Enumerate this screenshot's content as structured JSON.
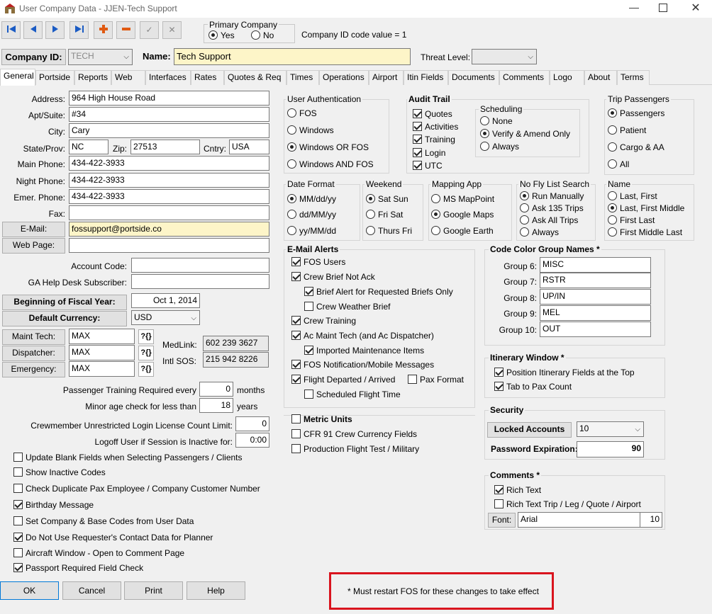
{
  "window": {
    "title": "User Company Data - JJEN-Tech Support"
  },
  "toolbar": {
    "primary_company_label": "Primary Company",
    "yes": "Yes",
    "no": "No",
    "company_id_code_text": "Company ID code value = 1"
  },
  "header": {
    "company_id_label": "Company ID:",
    "company_id_value": "TECH",
    "name_label": "Name:",
    "name_value": "Tech Support",
    "threat_level_label": "Threat Level:"
  },
  "tabs": [
    "General",
    "Portside",
    "Reports",
    "Web",
    "Interfaces",
    "Rates",
    "Quotes & Req",
    "Times",
    "Operations",
    "Airport",
    "Itin Fields",
    "Documents",
    "Comments",
    "Logo",
    "About",
    "Terms"
  ],
  "general": {
    "address_label": "Address:",
    "address": "964 High House Road",
    "apt_label": "Apt/Suite:",
    "apt": "#34",
    "city_label": "City:",
    "city": "Cary",
    "state_label": "State/Prov:",
    "state": "NC",
    "zip_label": "Zip:",
    "zip": "27513",
    "cntry_label": "Cntry:",
    "cntry": "USA",
    "main_phone_label": "Main Phone:",
    "main_phone": "434-422-3933",
    "night_phone_label": "Night Phone:",
    "night_phone": "434-422-3933",
    "emer_phone_label": "Emer. Phone:",
    "emer_phone": "434-422-3933",
    "fax_label": "Fax:",
    "email_button": "E-Mail:",
    "email": "fossupport@portside.co",
    "webpage_button": "Web Page:",
    "account_code_label": "Account Code:",
    "ga_help_label": "GA Help Desk Subscriber:",
    "fiscal_year_button": "Beginning of Fiscal Year:",
    "fiscal_year": "Oct 1, 2014",
    "currency_button": "Default Currency:",
    "currency": "USD",
    "maint_tech_button": "Maint Tech:",
    "maint_tech": "MAX",
    "dispatcher_button": "Dispatcher:",
    "dispatcher": "MAX",
    "emergency_button": "Emergency:",
    "emergency": "MAX",
    "pick_glyph": "?{}",
    "medlink_label": "MedLink:",
    "medlink": "602 239 3627",
    "intl_sos_label": "Intl SOS:",
    "intl_sos": "215 942 8226",
    "pax_training_label": "Passenger Training Required every",
    "pax_training_value": "0",
    "pax_training_unit": "months",
    "minor_age_label": "Minor age check for less than",
    "minor_age_value": "18",
    "minor_age_unit": "years",
    "crew_license_label": "Crewmember Unrestricted Login License Count Limit:",
    "crew_license_value": "0",
    "logoff_label": "Logoff User if Session is Inactive for:",
    "logoff_value": "0:00",
    "checks": [
      {
        "label": "Update Blank Fields when Selecting Passengers / Clients",
        "checked": false
      },
      {
        "label": "Show Inactive Codes",
        "checked": false
      },
      {
        "label": "Check Duplicate Pax Employee / Company Customer Number",
        "checked": false
      },
      {
        "label": "Birthday Message",
        "checked": true
      },
      {
        "label": "Set Company & Base Codes from User Data",
        "checked": false
      },
      {
        "label": "Do Not Use Requester's Contact Data for Planner",
        "checked": true
      },
      {
        "label": "Aircraft Window - Open to Comment Page",
        "checked": false
      },
      {
        "label": "Passport Required Field Check",
        "checked": true
      }
    ]
  },
  "user_auth": {
    "title": "User Authentication",
    "options": [
      "FOS",
      "Windows",
      "Windows OR FOS",
      "Windows AND FOS"
    ],
    "selected": 2
  },
  "audit_trail": {
    "title": "Audit Trail",
    "items": [
      {
        "label": "Quotes",
        "checked": true
      },
      {
        "label": "Activities",
        "checked": true
      },
      {
        "label": "Training",
        "checked": true
      },
      {
        "label": "Login",
        "checked": true
      },
      {
        "label": "UTC",
        "checked": true
      }
    ]
  },
  "scheduling": {
    "title": "Scheduling",
    "options": [
      "None",
      "Verify & Amend Only",
      "Always"
    ],
    "selected": 1
  },
  "trip_passengers": {
    "title": "Trip Passengers",
    "options": [
      "Passengers",
      "Patient",
      "Cargo & AA",
      "All"
    ],
    "selected": 0
  },
  "date_format": {
    "title": "Date Format",
    "options": [
      "MM/dd/yy",
      "dd/MM/yy",
      "yy/MM/dd"
    ],
    "selected": 0
  },
  "weekend": {
    "title": "Weekend",
    "options": [
      "Sat Sun",
      "Fri Sat",
      "Thurs Fri"
    ],
    "selected": 0
  },
  "mapping_app": {
    "title": "Mapping App",
    "options": [
      "MS MapPoint",
      "Google Maps",
      "Google Earth"
    ],
    "selected": 1
  },
  "no_fly": {
    "title": "No Fly List Search",
    "options": [
      "Run Manually",
      "Ask 135 Trips",
      "Ask All Trips",
      "Always"
    ],
    "selected": 0
  },
  "name_fmt": {
    "title": "Name",
    "options": [
      "Last, First",
      "Last, First Middle",
      "First Last",
      "First Middle Last"
    ],
    "selected": 1
  },
  "email_alerts": {
    "title": "E-Mail Alerts",
    "fos_users": "FOS Users",
    "crew_brief_not_ack": "Crew Brief Not Ack",
    "brief_alert": "Brief Alert for Requested Briefs Only",
    "crew_weather": "Crew Weather Brief",
    "crew_training": "Crew Training",
    "ac_maint": "Ac Maint Tech (and Ac Dispatcher)",
    "imported_maint": "Imported Maintenance Items",
    "fos_notification": "FOS Notification/Mobile Messages",
    "flight_departed": "Flight Departed / Arrived",
    "pax_format": "Pax Format",
    "scheduled_flight": "Scheduled Flight Time"
  },
  "misc": {
    "metric": "Metric Units",
    "cfr91": "CFR 91 Crew Currency Fields",
    "production": "Production Flight Test / Military"
  },
  "code_color": {
    "title": "Code Color Group Names *",
    "groups": [
      {
        "label": "Group 6:",
        "value": "MISC"
      },
      {
        "label": "Group 7:",
        "value": "RSTR"
      },
      {
        "label": "Group 8:",
        "value": "UP/IN"
      },
      {
        "label": "Group 9:",
        "value": "MEL"
      },
      {
        "label": "Group 10:",
        "value": "OUT"
      }
    ]
  },
  "itinerary": {
    "title": "Itinerary Window *",
    "position_fields": "Position Itinerary Fields at the Top",
    "tab_to_pax": "Tab to Pax Count"
  },
  "security": {
    "title": "Security",
    "locked_button": "Locked Accounts",
    "locked_value": "10",
    "pw_label": "Password Expiration:",
    "pw_value": "90"
  },
  "comments": {
    "title": "Comments *",
    "rich_text": "Rich Text",
    "rich_text_trip": "Rich Text Trip / Leg / Quote / Airport",
    "font_button": "Font:",
    "font_value": "Arial",
    "font_size": "10"
  },
  "footer": {
    "ok": "OK",
    "cancel": "Cancel",
    "print": "Print",
    "help": "Help",
    "note": "* Must restart FOS for these changes to take effect"
  },
  "colors": {
    "accent": "#0a64c8",
    "highlight_field": "#fdf5c8",
    "callout_border": "#d9141e"
  }
}
